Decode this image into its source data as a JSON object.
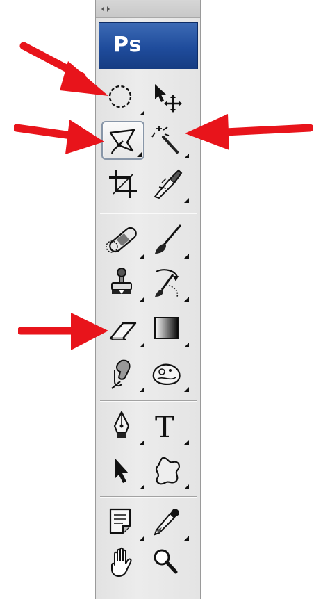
{
  "app": {
    "logo_text": "Ps",
    "logo_colors": [
      "#3c6ab4",
      "#163c82"
    ]
  },
  "toolbar": {
    "collapse_icon": "double-arrow-icon",
    "groups": [
      {
        "tools": [
          "elliptical-marquee-tool",
          "move-tool",
          "polygonal-lasso-tool",
          "magic-wand-tool",
          "crop-tool",
          "slice-tool"
        ]
      },
      {
        "tools": [
          "spot-healing-brush-tool",
          "brush-tool",
          "clone-stamp-tool",
          "history-brush-tool",
          "eraser-tool",
          "gradient-tool",
          "burn-tool",
          "sponge-tool"
        ]
      },
      {
        "tools": [
          "pen-tool",
          "type-tool",
          "direct-selection-tool",
          "custom-shape-tool"
        ]
      },
      {
        "tools": [
          "notes-tool",
          "eyedropper-tool",
          "hand-tool",
          "zoom-tool"
        ]
      }
    ],
    "selected_tool": "polygonal-lasso-tool",
    "type_tool_glyph": "T"
  },
  "annotations": {
    "arrow_color": "#e8141b",
    "arrows_point_to": [
      "elliptical-marquee-tool",
      "polygonal-lasso-tool",
      "magic-wand-tool",
      "eraser-tool"
    ]
  }
}
